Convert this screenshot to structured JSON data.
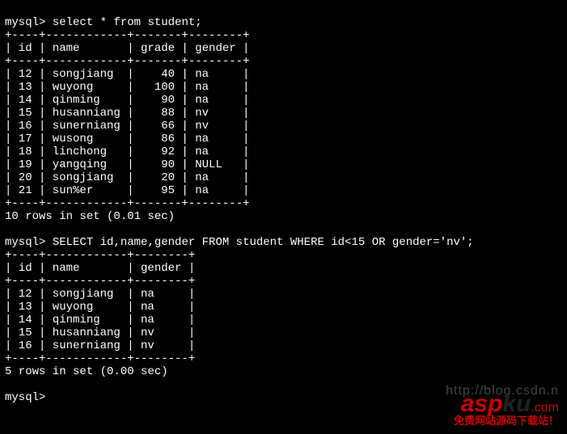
{
  "prompt": "mysql>",
  "cmd1": "select * from student;",
  "table1": {
    "border_top": "+----+------------+-------+--------+",
    "header": "| id | name       | grade | gender |",
    "border_mid": "+----+------------+-------+--------+",
    "rows": [
      "| 12 | songjiang  |    40 | na     |",
      "| 13 | wuyong     |   100 | na     |",
      "| 14 | qinming    |    90 | na     |",
      "| 15 | husanniang |    88 | nv     |",
      "| 16 | sunerniang |    66 | nv     |",
      "| 17 | wusong     |    86 | na     |",
      "| 18 | linchong   |    92 | na     |",
      "| 19 | yangqing   |    90 | NULL   |",
      "| 20 | songjiang  |    20 | na     |",
      "| 21 | sun%er     |    95 | na     |"
    ],
    "border_bot": "+----+------------+-------+--------+",
    "summary": "10 rows in set (0.01 sec)"
  },
  "cmd2": "SELECT id,name,gender FROM student WHERE id<15 OR gender='nv';",
  "table2": {
    "border_top": "+----+------------+--------+",
    "header": "| id | name       | gender |",
    "border_mid": "+----+------------+--------+",
    "rows": [
      "| 12 | songjiang  | na     |",
      "| 13 | wuyong     | na     |",
      "| 14 | qinming    | na     |",
      "| 15 | husanniang | nv     |",
      "| 16 | sunerniang | nv     |"
    ],
    "border_bot": "+----+------------+--------+",
    "summary": "5 rows in set (0.00 sec)"
  },
  "watermark": {
    "url": "http://blog.csdn.n",
    "brand_prefix": "asp",
    "brand_mid": "ku",
    "brand_dot": ".com",
    "sub": "免费网站源码下载站！"
  },
  "chart_data": {
    "type": "table",
    "query1": {
      "sql": "select * from student;",
      "columns": [
        "id",
        "name",
        "grade",
        "gender"
      ],
      "rows": [
        {
          "id": 12,
          "name": "songjiang",
          "grade": 40,
          "gender": "na"
        },
        {
          "id": 13,
          "name": "wuyong",
          "grade": 100,
          "gender": "na"
        },
        {
          "id": 14,
          "name": "qinming",
          "grade": 90,
          "gender": "na"
        },
        {
          "id": 15,
          "name": "husanniang",
          "grade": 88,
          "gender": "nv"
        },
        {
          "id": 16,
          "name": "sunerniang",
          "grade": 66,
          "gender": "nv"
        },
        {
          "id": 17,
          "name": "wusong",
          "grade": 86,
          "gender": "na"
        },
        {
          "id": 18,
          "name": "linchong",
          "grade": 92,
          "gender": "na"
        },
        {
          "id": 19,
          "name": "yangqing",
          "grade": 90,
          "gender": null
        },
        {
          "id": 20,
          "name": "songjiang",
          "grade": 20,
          "gender": "na"
        },
        {
          "id": 21,
          "name": "sun%er",
          "grade": 95,
          "gender": "na"
        }
      ],
      "row_count": 10,
      "time_sec": 0.01
    },
    "query2": {
      "sql": "SELECT id,name,gender FROM student WHERE id<15 OR gender='nv';",
      "columns": [
        "id",
        "name",
        "gender"
      ],
      "rows": [
        {
          "id": 12,
          "name": "songjiang",
          "gender": "na"
        },
        {
          "id": 13,
          "name": "wuyong",
          "gender": "na"
        },
        {
          "id": 14,
          "name": "qinming",
          "gender": "na"
        },
        {
          "id": 15,
          "name": "husanniang",
          "gender": "nv"
        },
        {
          "id": 16,
          "name": "sunerniang",
          "gender": "nv"
        }
      ],
      "row_count": 5,
      "time_sec": 0.0
    }
  }
}
